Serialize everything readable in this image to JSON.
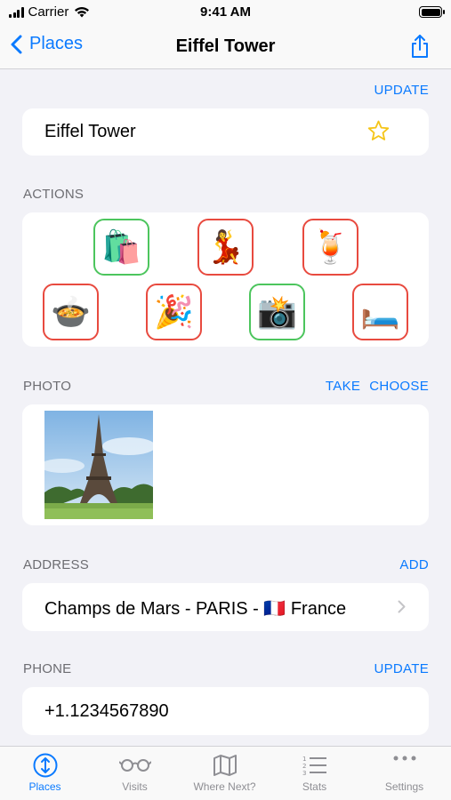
{
  "status_bar": {
    "carrier": "Carrier",
    "time": "9:41 AM"
  },
  "nav": {
    "back_label": "Places",
    "title": "Eiffel Tower"
  },
  "name_section": {
    "action": "UPDATE",
    "value": "Eiffel Tower"
  },
  "actions_section": {
    "label": "ACTIONS",
    "items": [
      {
        "name": "shopping",
        "emoji": "🛍️",
        "state": "green"
      },
      {
        "name": "dancing",
        "emoji": "💃",
        "state": "red"
      },
      {
        "name": "cocktail",
        "emoji": "🍹",
        "state": "red"
      },
      {
        "name": "food",
        "emoji": "🍲",
        "state": "red"
      },
      {
        "name": "party",
        "emoji": "🎉",
        "state": "red"
      },
      {
        "name": "photo",
        "emoji": "📸",
        "state": "green"
      },
      {
        "name": "sleep",
        "emoji": "🛏️",
        "state": "red"
      }
    ]
  },
  "photo_section": {
    "label": "PHOTO",
    "take": "TAKE",
    "choose": "CHOOSE"
  },
  "address_section": {
    "label": "ADDRESS",
    "action": "ADD",
    "value": "Champs de Mars - PARIS - 🇫🇷 France"
  },
  "phone_section": {
    "label": "PHONE",
    "action": "UPDATE",
    "value": "+1.1234567890"
  },
  "tabs": [
    {
      "label": "Places",
      "icon": "places-icon",
      "active": true
    },
    {
      "label": "Visits",
      "icon": "glasses-icon",
      "active": false
    },
    {
      "label": "Where Next?",
      "icon": "map-icon",
      "active": false
    },
    {
      "label": "Stats",
      "icon": "list-icon",
      "active": false
    },
    {
      "label": "Settings",
      "icon": "more-icon",
      "active": false
    }
  ],
  "colors": {
    "accent": "#0a7aff",
    "green": "#4cc55d",
    "red": "#e84a3f",
    "star": "#f5c518"
  }
}
